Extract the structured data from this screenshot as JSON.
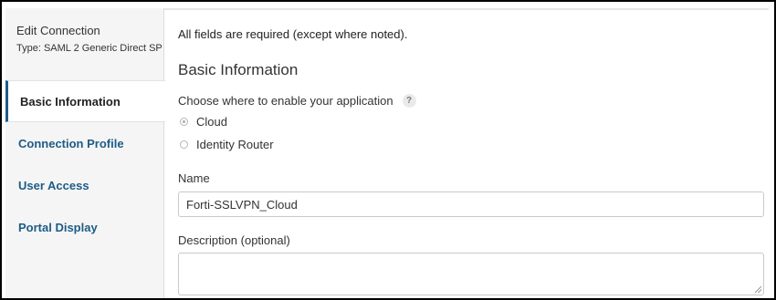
{
  "sidebar": {
    "connection_title": "Edit Connection",
    "connection_type": "Type: SAML 2 Generic Direct SP",
    "items": [
      {
        "label": "Basic Information"
      },
      {
        "label": "Connection Profile"
      },
      {
        "label": "User Access"
      },
      {
        "label": "Portal Display"
      }
    ]
  },
  "main": {
    "required_note": "All fields are required (except where noted).",
    "section_title": "Basic Information",
    "choose_label": "Choose where to enable your application",
    "help_icon_glyph": "?",
    "options": [
      {
        "label": "Cloud",
        "selected": true
      },
      {
        "label": "Identity Router",
        "selected": false
      }
    ],
    "name_label": "Name",
    "name_value": "Forti-SSLVPN_Cloud",
    "description_label": "Description (optional)",
    "description_value": ""
  },
  "colors": {
    "accent": "#1d5c86",
    "sidebar_bg": "#f5f5f5"
  }
}
